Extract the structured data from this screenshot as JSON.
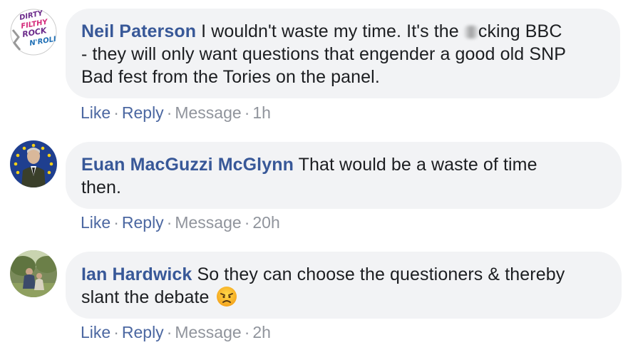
{
  "comments": [
    {
      "author": "Neil Paterson",
      "text_before": " I wouldn't waste my time. It's the ",
      "text_after": "cking BBC",
      "line2": "- they will only want questions that engender a good old SNP",
      "line3": "Bad fest from the Tories on the panel.",
      "avatar_text": [
        "DIRTY",
        "FILTHY",
        "ROCK",
        "N'ROLL"
      ],
      "like": "Like",
      "reply": "Reply",
      "message": "Message",
      "time": "1h"
    },
    {
      "author": "Euan MacGuzzi McGlynn",
      "text": " That would be a waste of time",
      "line2": "then.",
      "like": "Like",
      "reply": "Reply",
      "message": "Message",
      "time": "20h"
    },
    {
      "author": "Ian Hardwick",
      "text": " So they can choose the questioners & thereby",
      "line2": "slant the debate",
      "emoji": "angry-face",
      "like": "Like",
      "reply": "Reply",
      "message": "Message",
      "time": "2h"
    }
  ],
  "separator": "·",
  "colors": {
    "name": "#385898",
    "bubble": "#f2f3f5",
    "link": "#4b67a1",
    "meta": "#90949c"
  }
}
